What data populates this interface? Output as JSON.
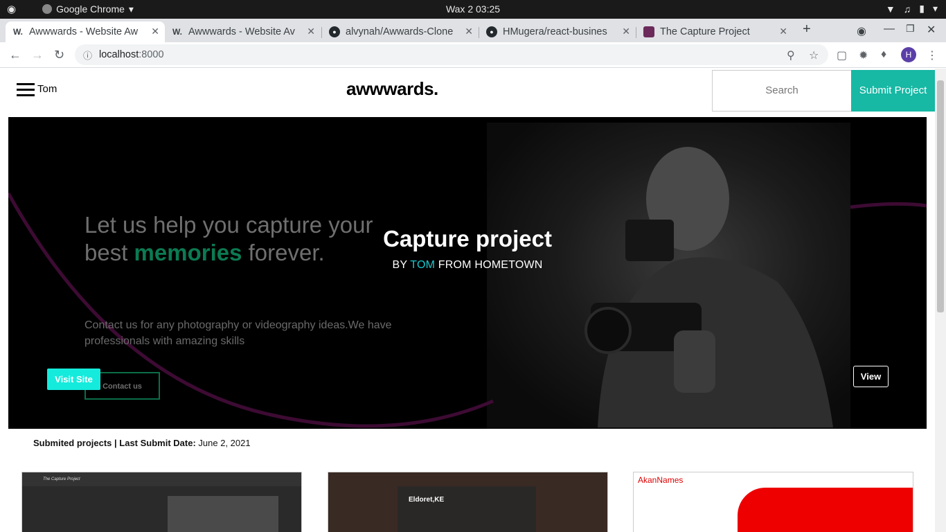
{
  "os": {
    "app_name": "Google Chrome",
    "clock": "Wax 2  03:25"
  },
  "browser": {
    "tabs": [
      {
        "title": "Awwwards - Website Aw",
        "favicon": "W."
      },
      {
        "title": "Awwwards - Website Av",
        "favicon": "W."
      },
      {
        "title": "alvynah/Awwards-Clone",
        "favicon": "github-icon"
      },
      {
        "title": "HMugera/react-busines",
        "favicon": "github-icon"
      },
      {
        "title": "The Capture Project",
        "favicon": "page-icon"
      }
    ],
    "url_host": "localhost",
    "url_port": ":8000",
    "profile_initial": "H"
  },
  "site": {
    "username": "Tom",
    "logo": "awwwards.",
    "search_placeholder": "Search",
    "submit_label": "Submit Project"
  },
  "hero": {
    "headline_part1": "Let us help you capture your best ",
    "headline_accent": "memories",
    "headline_part2": " forever.",
    "paragraph": "Contact us for any photography or videography ideas.We have professionals with amazing skills",
    "contact_label": "Contact us",
    "project_title": "Capture project",
    "by_prefix": "BY ",
    "author": "TOM",
    "by_suffix": " FROM HOMETOWN",
    "visit_label": "Visit Site",
    "view_label": "View"
  },
  "submitted": {
    "label": "Submited projects | Last Submit Date:",
    "date": "June 2, 2021"
  },
  "cards": [
    {
      "name": "The Capture Project"
    },
    {
      "name": "Eldoret,KE"
    },
    {
      "name": "AkanNames"
    }
  ],
  "colors": {
    "accent_teal": "#17b8a4",
    "visit_cyan": "#14ebdc",
    "author_cyan": "#17c9cf",
    "memories_green": "#0c7a52"
  }
}
